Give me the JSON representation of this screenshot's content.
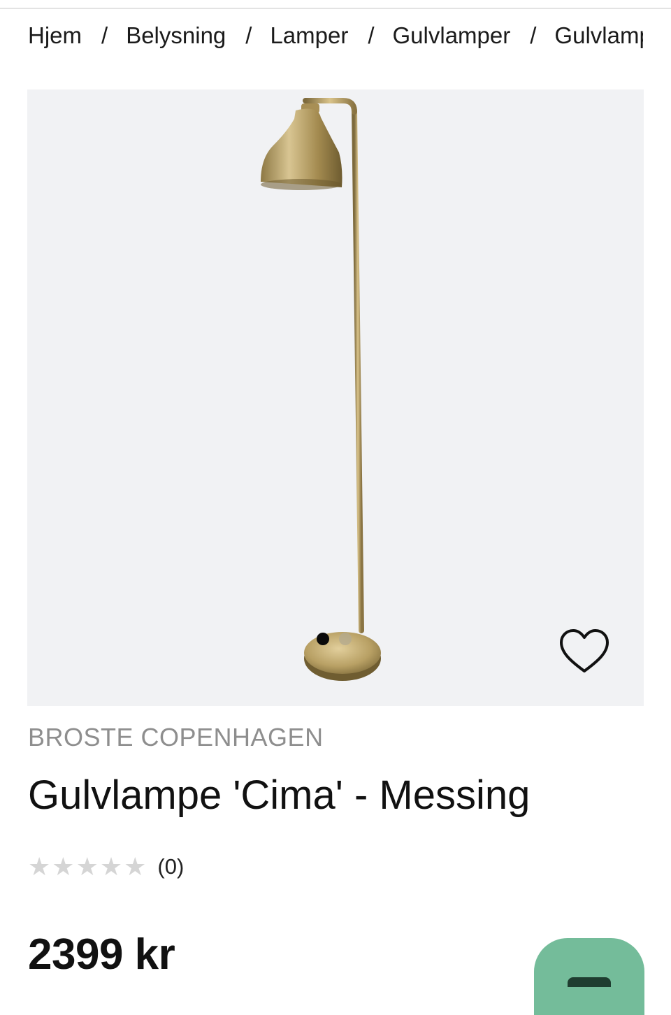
{
  "breadcrumb": {
    "items": [
      "Hjem",
      "Belysning",
      "Lamper",
      "Gulvlamper",
      "Gulvlampe"
    ],
    "separator": "/"
  },
  "gallery": {
    "image_count": 2,
    "active_index": 0,
    "favorite_icon": "heart-outline-icon"
  },
  "product": {
    "brand": "BROSTE COPENHAGEN",
    "title": "Gulvlampe 'Cima' - Messing",
    "rating_stars": 0,
    "rating_max": 5,
    "review_count": "(0)",
    "price": "2399 kr"
  },
  "colors": {
    "accent_button": "#74bc9a",
    "gallery_bg": "#f1f2f4",
    "brass": "#b59a5e"
  }
}
